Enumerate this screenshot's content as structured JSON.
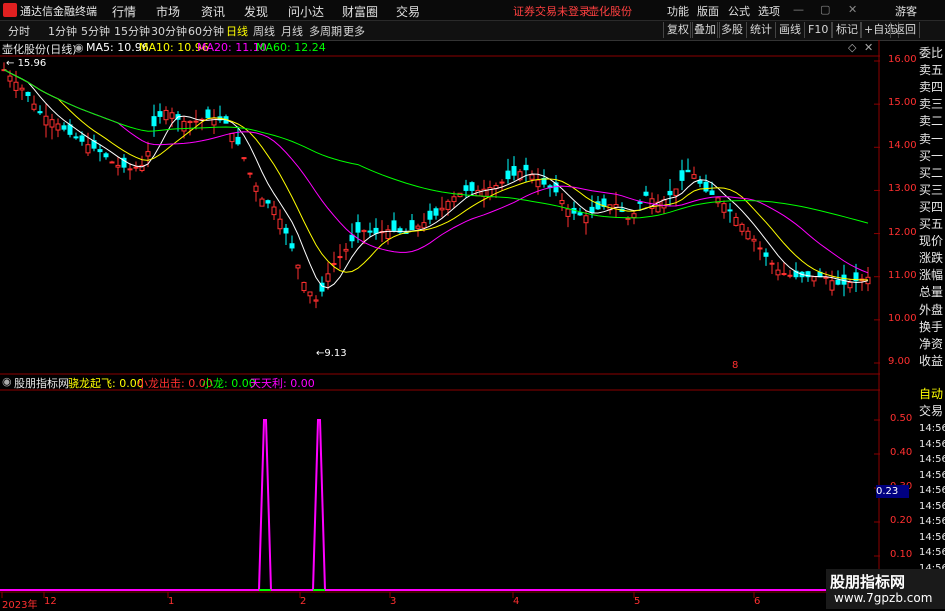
{
  "menubar": {
    "app_title": "通达信金融终端",
    "items": [
      "行情",
      "市场",
      "资讯",
      "发现",
      "问小达",
      "财富圈",
      "交易"
    ],
    "notice": "证券交易未登录",
    "stock": "壶化股份",
    "right": [
      "功能",
      "版面",
      "公式",
      "选项"
    ],
    "guest": "游客"
  },
  "toolbar": {
    "periods": [
      "分时",
      "1分钟",
      "5分钟",
      "15分钟",
      "30分钟",
      "60分钟",
      "日线",
      "周线",
      "月线",
      "多周期",
      "更多"
    ],
    "active": "日线",
    "buttons": [
      "复权",
      "叠加",
      "多股",
      "统计",
      "画线",
      "F10",
      "标记",
      "+自选",
      "返回"
    ]
  },
  "kline": {
    "title": "壶化股份(日线)",
    "ma5": "MA5: 10.96",
    "ma10": "MA10: 10.96",
    "ma20": "MA20: 11.10",
    "ma60": "MA60: 12.24",
    "high_label": "15.96",
    "low_label": "9.13",
    "price_ticks": [
      "16.00",
      "15.00",
      "14.00",
      "13.00",
      "12.00",
      "11.00",
      "10.00",
      "9.00"
    ],
    "mark": "8"
  },
  "indicator": {
    "name": "股朋指标网",
    "l1": "骁龙起飞: 0.00",
    "l2": "小龙出击: 0.00",
    "l3": "小龙: 0.00",
    "l4": "天天利: 0.00",
    "ticks": [
      "0.50",
      "0.40",
      "0.30",
      "0.20",
      "0.10"
    ],
    "current": "0.23"
  },
  "xaxis": [
    "2023年",
    "12",
    "1",
    "2",
    "3",
    "4",
    "5",
    "6"
  ],
  "side_labels": [
    "委比",
    "卖五",
    "卖四",
    "卖三",
    "卖二",
    "卖一",
    "买一",
    "买二",
    "买三",
    "买四",
    "买五",
    "现价",
    "涨跌",
    "涨幅",
    "总量",
    "外盘",
    "换手",
    "净资",
    "收益"
  ],
  "side_lower": [
    "自动",
    "交易"
  ],
  "side_times": [
    "14:56",
    "14:56",
    "14:56",
    "14:56",
    "14:56",
    "14:56",
    "14:56",
    "14:56",
    "14:56",
    "14:56",
    "14:56"
  ],
  "watermark": {
    "title": "股朋指标网",
    "url": "www.7gpzb.com"
  },
  "colors": {
    "up": "#ff3030",
    "down": "#00ffff",
    "ma5": "#ffffff",
    "ma10": "#ffff00",
    "ma20": "#ff00ff",
    "ma60": "#00ff00",
    "signal": "#ff00ff"
  }
}
